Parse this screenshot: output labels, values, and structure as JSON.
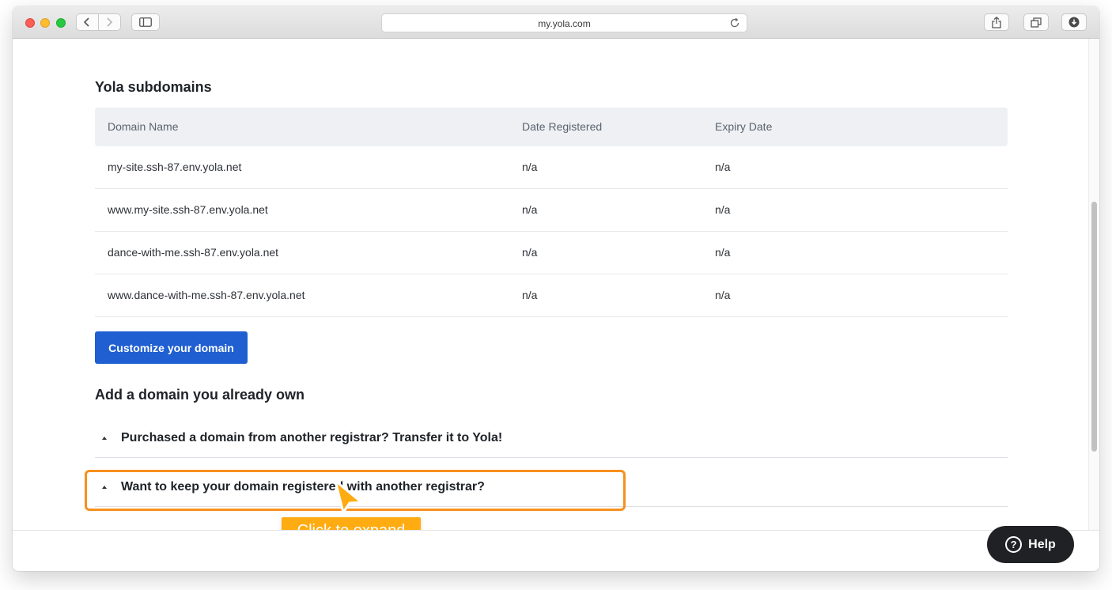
{
  "browser": {
    "url": "my.yola.com"
  },
  "subdomains": {
    "title": "Yola subdomains",
    "columns": [
      "Domain Name",
      "Date Registered",
      "Expiry Date"
    ],
    "rows": [
      {
        "domain": "my-site.ssh-87.env.yola.net",
        "registered": "n/a",
        "expiry": "n/a"
      },
      {
        "domain": "www.my-site.ssh-87.env.yola.net",
        "registered": "n/a",
        "expiry": "n/a"
      },
      {
        "domain": "dance-with-me.ssh-87.env.yola.net",
        "registered": "n/a",
        "expiry": "n/a"
      },
      {
        "domain": "www.dance-with-me.ssh-87.env.yola.net",
        "registered": "n/a",
        "expiry": "n/a"
      }
    ],
    "cta_label": "Customize your domain"
  },
  "own_domain": {
    "title": "Add a domain you already own",
    "accordions": [
      {
        "label": "Purchased a domain from another registrar? Transfer it to Yola!"
      },
      {
        "label": "Want to keep your domain registered with another registrar?"
      }
    ]
  },
  "tooltip": {
    "text": "Click to expand"
  },
  "help": {
    "label": "Help"
  },
  "colors": {
    "primary": "#1f5fd1",
    "highlight": "#f7901e",
    "tooltip": "#ffab12",
    "help_bg": "#202124"
  },
  "icons": [
    "back-icon",
    "forward-icon",
    "sidebar-icon",
    "reload-icon",
    "share-icon",
    "tabs-icon",
    "download-icon",
    "caret-up-icon",
    "pointer-cursor-icon",
    "question-icon"
  ]
}
